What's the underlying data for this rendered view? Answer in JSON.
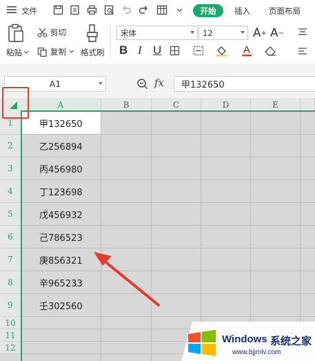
{
  "menu": {
    "file_label": "文件",
    "active_tab": "开始",
    "tabs": [
      "插入",
      "页面布局"
    ]
  },
  "ribbon": {
    "paste_label": "粘贴",
    "cut_label": "剪切",
    "copy_label": "复制",
    "format_painter_label": "格式刷",
    "font_name": "宋体",
    "font_size": "12"
  },
  "formula_bar": {
    "cell_ref": "A1",
    "fx_label": "fx",
    "content": "甲132650"
  },
  "sheet": {
    "columns": [
      "A",
      "B",
      "C",
      "D",
      "E"
    ],
    "rows": [
      "1",
      "2",
      "3",
      "4",
      "5",
      "6",
      "7",
      "8",
      "9",
      "10",
      "11",
      "12"
    ],
    "column_a_values": [
      "甲132650",
      "乙256894",
      "丙456980",
      "丁123698",
      "戊456932",
      "己786523",
      "庚856321",
      "辛965233",
      "壬302560"
    ]
  },
  "colors": {
    "accent_green": "#1ba86f",
    "annotation_red": "#e63a2e"
  },
  "watermark": {
    "brand": "Windows",
    "brand_cn": "系统之家",
    "url": "www.bjjmlv.com"
  }
}
